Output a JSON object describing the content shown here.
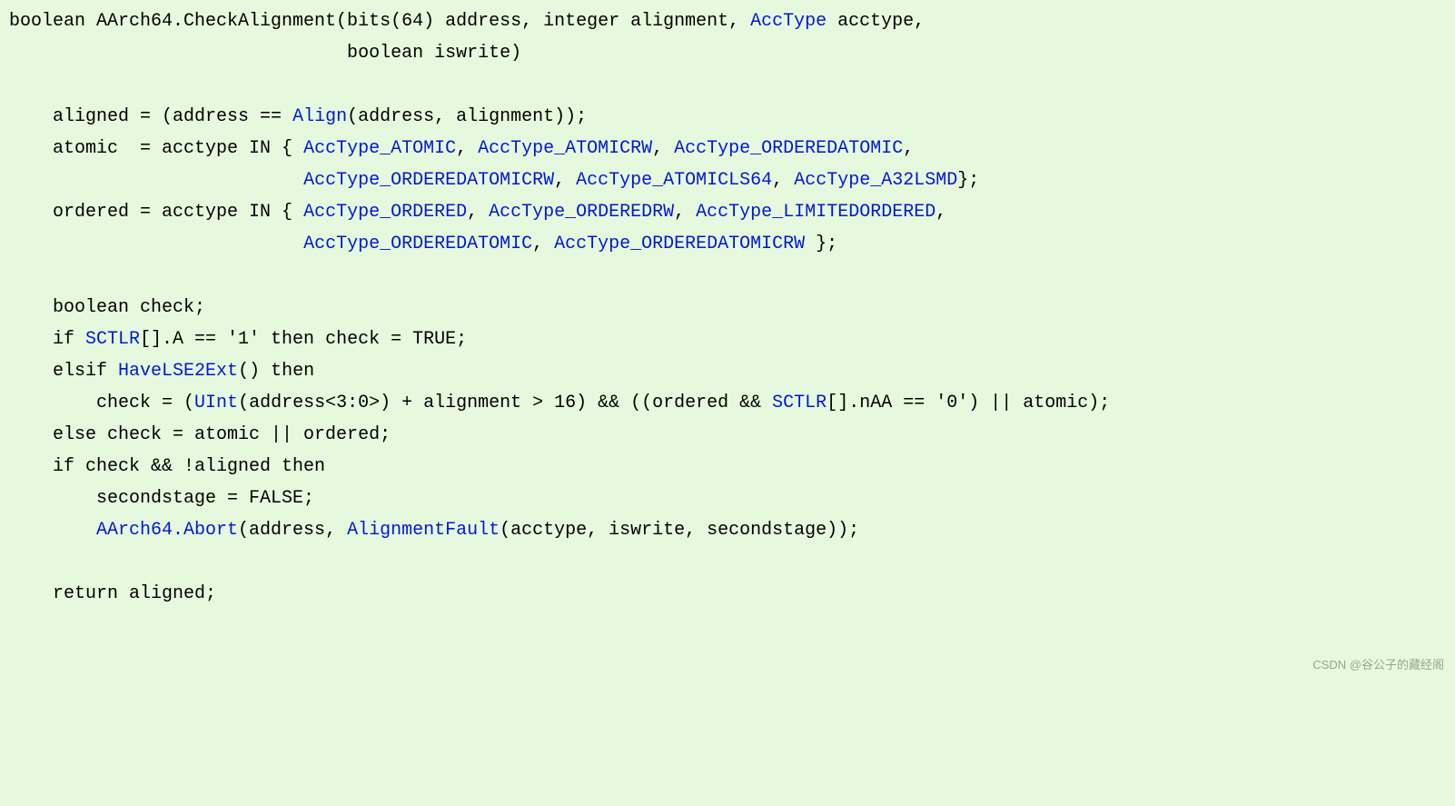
{
  "code": {
    "blank": " ",
    "l1a": "boolean AArch64.CheckAlignment(bits(64) address, integer alignment, ",
    "l1b": "AccType",
    "l1c": " acctype,",
    "l2": "                               boolean iswrite)",
    "l3a": "    aligned = (address == ",
    "l3b": "Align",
    "l3c": "(address, alignment));",
    "l4a": "    atomic  = acctype IN { ",
    "l4b": "AccType_ATOMIC",
    "l4c": ", ",
    "l4d": "AccType_ATOMICRW",
    "l4e": ", ",
    "l4f": "AccType_ORDEREDATOMIC",
    "l4g": ",",
    "l5a": "                           ",
    "l5b": "AccType_ORDEREDATOMICRW",
    "l5c": ", ",
    "l5d": "AccType_ATOMICLS64",
    "l5e": ", ",
    "l5f": "AccType_A32LSMD",
    "l5g": "};",
    "l6a": "    ordered = acctype IN { ",
    "l6b": "AccType_ORDERED",
    "l6c": ", ",
    "l6d": "AccType_ORDEREDRW",
    "l6e": ", ",
    "l6f": "AccType_LIMITEDORDERED",
    "l6g": ",",
    "l7a": "                           ",
    "l7b": "AccType_ORDEREDATOMIC",
    "l7c": ", ",
    "l7d": "AccType_ORDEREDATOMICRW",
    "l7e": " };",
    "l8": "    boolean check;",
    "l9a": "    if ",
    "l9b": "SCTLR",
    "l9c": "[].A == '1' then check = TRUE;",
    "l10a": "    elsif ",
    "l10b": "HaveLSE2Ext",
    "l10c": "() then",
    "l11a": "        check = (",
    "l11b": "UInt",
    "l11c": "(address<3:0>) + alignment > 16) && ((ordered && ",
    "l11d": "SCTLR",
    "l11e": "[].nAA == '0') || atomic);",
    "l12": "    else check = atomic || ordered;",
    "l13": "    if check && !aligned then",
    "l14": "        secondstage = FALSE;",
    "l15a": "        ",
    "l15b": "AArch64.Abort",
    "l15c": "(address, ",
    "l15d": "AlignmentFault",
    "l15e": "(acctype, iswrite, secondstage));",
    "l16": "    return aligned;"
  },
  "watermark": "CSDN @谷公子的藏经阁"
}
